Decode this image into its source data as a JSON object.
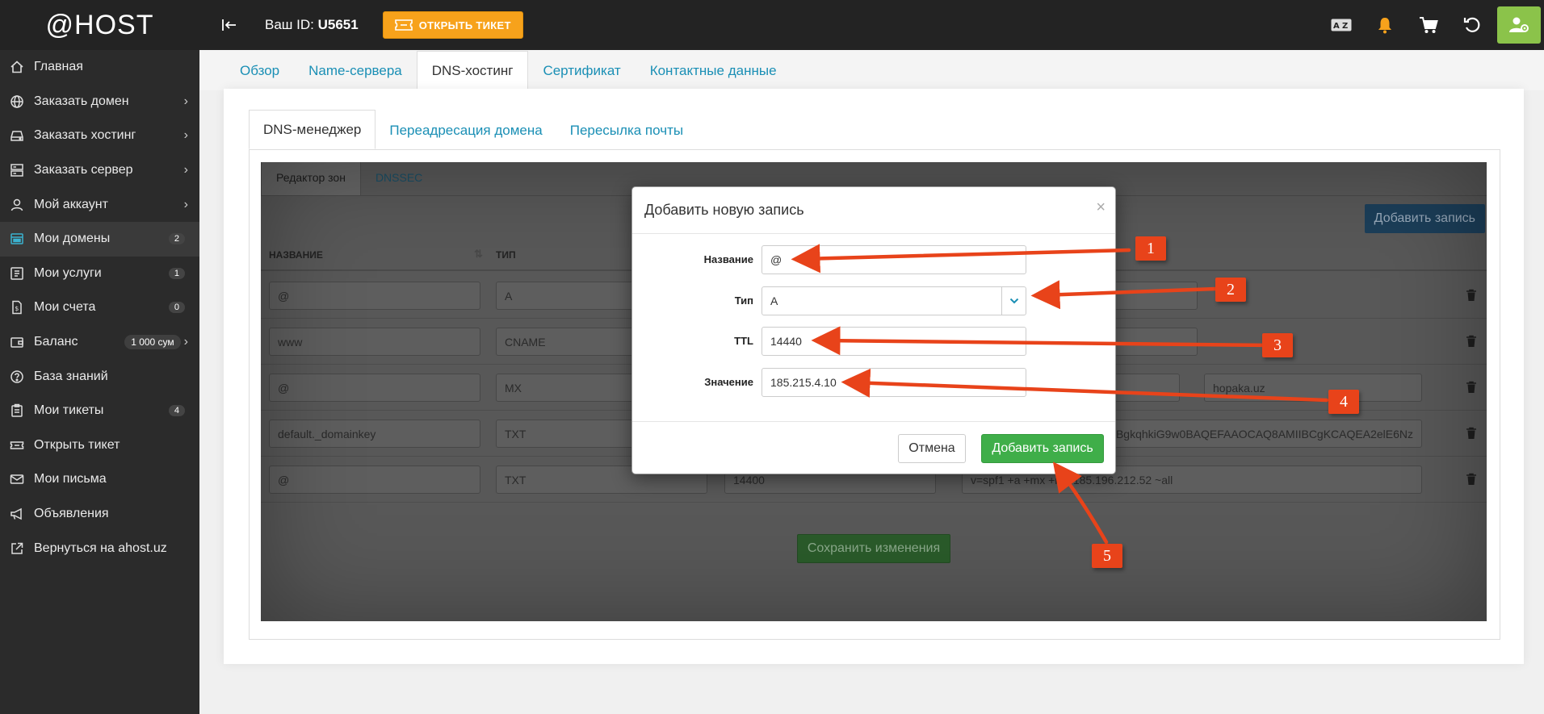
{
  "brand": {
    "logo": "@HOST"
  },
  "sidebar": {
    "items": [
      {
        "label": "Главная",
        "icon": "home-icon"
      },
      {
        "label": "Заказать домен",
        "icon": "globe-icon",
        "chevron": "›"
      },
      {
        "label": "Заказать хостинг",
        "icon": "hdd-icon",
        "chevron": "›"
      },
      {
        "label": "Заказать сервер",
        "icon": "server-icon",
        "chevron": "›"
      },
      {
        "label": "Мой аккаунт",
        "icon": "user-icon",
        "chevron": "›"
      },
      {
        "label": "Мои домены",
        "icon": "domain-icon",
        "badge": "2"
      },
      {
        "label": "Мои услуги",
        "icon": "services-icon",
        "badge": "1"
      },
      {
        "label": "Мои счета",
        "icon": "invoice-icon",
        "badge": "0"
      },
      {
        "label": "Баланс",
        "icon": "wallet-icon",
        "badge": "1 000 сум",
        "chevron": "›"
      },
      {
        "label": "База знаний",
        "icon": "question-icon"
      },
      {
        "label": "Мои тикеты",
        "icon": "tickets-icon",
        "badge": "4"
      },
      {
        "label": "Открыть тикет",
        "icon": "ticket-icon"
      },
      {
        "label": "Мои письма",
        "icon": "mail-icon"
      },
      {
        "label": "Объявления",
        "icon": "megaphone-icon"
      },
      {
        "label": "Вернуться на ahost.uz",
        "icon": "external-link-icon"
      }
    ]
  },
  "topbar": {
    "id_prefix": "Ваш ID:",
    "id_value": "U5651",
    "open_ticket": "ОТКРЫТЬ ТИКЕТ"
  },
  "main_tabs": [
    "Обзор",
    "Name-сервера",
    "DNS-хостинг",
    "Сертификат",
    "Контактные данные"
  ],
  "inner_tabs": [
    "DNS-менеджер",
    "Переадресация домена",
    "Пересылка почты"
  ],
  "zone": {
    "tabs": [
      "Редактор зон",
      "DNSSEC"
    ],
    "add_button": "Добавить запись",
    "headers": [
      "НАЗВАНИЕ",
      "ТИП"
    ],
    "sort_glyph": "⇅",
    "rows": [
      {
        "name": "@",
        "type": "A",
        "ttl": "",
        "value": "",
        "extra": ""
      },
      {
        "name": "www",
        "type": "CNAME",
        "ttl": "",
        "value": "",
        "extra": ""
      },
      {
        "name": "@",
        "type": "MX",
        "ttl": "",
        "value": "",
        "extra": "hopaka.uz"
      },
      {
        "name": "default._domainkey",
        "type": "TXT",
        "ttl": "",
        "value": "BgkqhkiG9w0BAQEFAAOCAQ8AMIIBCgKCAQEA2elE6Nz",
        "extra": ""
      },
      {
        "name": "@",
        "type": "TXT",
        "ttl": "14400",
        "value": "v=spf1 +a +mx +ip4:185.196.212.52 ~all",
        "extra": ""
      }
    ],
    "save_button": "Сохранить изменения"
  },
  "modal": {
    "title": "Добавить новую запись",
    "close": "×",
    "fields": {
      "name_label": "Название",
      "name_value": "@",
      "type_label": "Тип",
      "type_value": "A",
      "ttl_label": "TTL",
      "ttl_value": "14440",
      "value_label": "Значение",
      "value_value": "185.215.4.10"
    },
    "cancel": "Отмена",
    "submit": "Добавить запись"
  },
  "annotations": [
    "1",
    "2",
    "3",
    "4",
    "5"
  ],
  "colors": {
    "sidebar_bg": "#2b2b2b",
    "topbar_bg": "#232323",
    "accent_orange": "#f7a21b",
    "link_blue": "#1a8fb5",
    "success_green": "#3fae49",
    "callout_red": "#e8431a",
    "user_green": "#8bc34a"
  }
}
